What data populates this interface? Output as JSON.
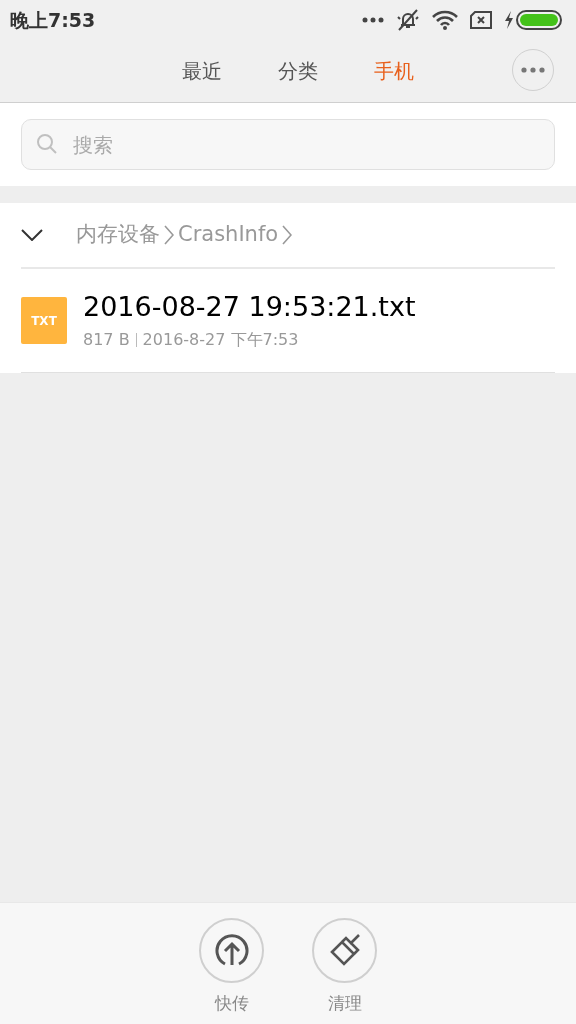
{
  "status_bar": {
    "time": "晚上7:53"
  },
  "tabs": [
    {
      "label": "最近",
      "selected": false
    },
    {
      "label": "分类",
      "selected": false
    },
    {
      "label": "手机",
      "selected": true
    }
  ],
  "search": {
    "placeholder": "搜索"
  },
  "breadcrumb": {
    "expanded": true,
    "items": [
      "内存设备",
      "CrashInfo"
    ]
  },
  "files": [
    {
      "badge": "TXT",
      "name": "2016-08-27 19:53:21.txt",
      "size": "817 B",
      "date": "2016-8-27 下午7:53"
    }
  ],
  "bottom_actions": [
    {
      "kind": "share",
      "label": "快传"
    },
    {
      "kind": "clean",
      "label": "清理"
    }
  ]
}
